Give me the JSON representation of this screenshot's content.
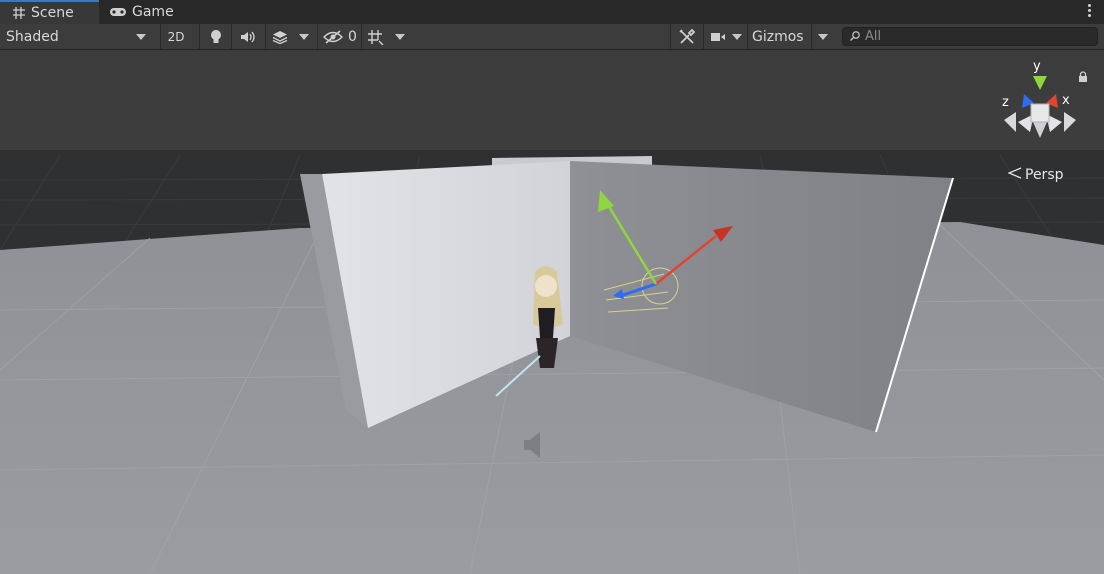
{
  "tabs": [
    {
      "label": "Scene",
      "icon": "grid-icon",
      "active": true
    },
    {
      "label": "Game",
      "icon": "gamepad-icon",
      "active": false
    }
  ],
  "toolbar": {
    "draw_mode": "Shaded",
    "mode_2d_label": "2D",
    "hidden_count": "0",
    "gizmos_label": "Gizmos",
    "search_placeholder": "All"
  },
  "gizmo": {
    "axis_y": "y",
    "axis_x": "x",
    "axis_z": "z",
    "projection": "Persp"
  },
  "colors": {
    "axis_x": "#e0462f",
    "axis_y": "#8fd63f",
    "axis_z": "#2f6cf0",
    "active_tab_accent": "#3a79bb"
  }
}
